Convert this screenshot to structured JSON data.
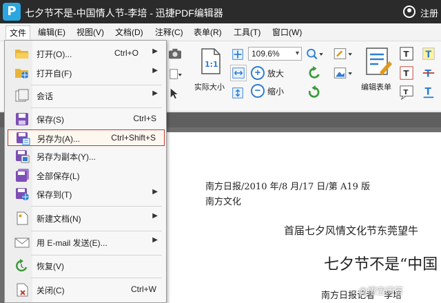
{
  "window": {
    "title": "七夕节不是-中国情人节-李培 - 迅捷PDF编辑器",
    "user": "注册"
  },
  "menubar": {
    "items": [
      "文件",
      "编辑(E)",
      "视图(V)",
      "文档(D)",
      "注释(C)",
      "表单(R)",
      "工具(T)",
      "窗口(W)"
    ]
  },
  "toolbar": {
    "actual_size": "实际大小",
    "actual_size_glyph": "1:1",
    "zoom_value": "109.6%",
    "zoom_in": "放大",
    "zoom_out": "缩小",
    "edit_form": "编辑表单"
  },
  "file_menu": {
    "items": [
      {
        "label": "打开(O)...",
        "shortcut": "Ctrl+O",
        "submenu": true,
        "icon": "open-folder-icon"
      },
      {
        "label": "打开自(F)",
        "shortcut": "",
        "submenu": true,
        "icon": "open-from-icon"
      },
      {
        "label": "会话",
        "shortcut": "",
        "submenu": true,
        "icon": "session-icon"
      },
      {
        "label": "保存(S)",
        "shortcut": "Ctrl+S",
        "submenu": false,
        "icon": "save-icon"
      },
      {
        "label": "另存为(A)...",
        "shortcut": "Ctrl+Shift+S",
        "submenu": false,
        "icon": "save-as-icon"
      },
      {
        "label": "另存为副本(Y)...",
        "shortcut": "",
        "submenu": false,
        "icon": "save-copy-icon"
      },
      {
        "label": "全部保存(L)",
        "shortcut": "",
        "submenu": false,
        "icon": "save-all-icon"
      },
      {
        "label": "保存到(T)",
        "shortcut": "",
        "submenu": true,
        "icon": "save-to-icon"
      },
      {
        "label": "新建文档(N)",
        "shortcut": "",
        "submenu": true,
        "icon": "new-document-icon"
      },
      {
        "label": "用 E-mail 发送(E)...",
        "shortcut": "",
        "submenu": true,
        "icon": "email-icon"
      },
      {
        "label": "恢复(V)",
        "shortcut": "",
        "submenu": false,
        "icon": "restore-icon"
      },
      {
        "label": "关闭(C)",
        "shortcut": "Ctrl+W",
        "submenu": false,
        "icon": "close-document-icon"
      }
    ]
  },
  "document": {
    "line1": "南方日报/2010 年/8 月/17 日/第 A19 版",
    "line2": "南方文化",
    "heading": "首届七夕风情文化节东莞望牛",
    "title": "七夕节不是“中国",
    "byline": "南方日报记者　李培"
  },
  "watermark": "@悟空问答"
}
